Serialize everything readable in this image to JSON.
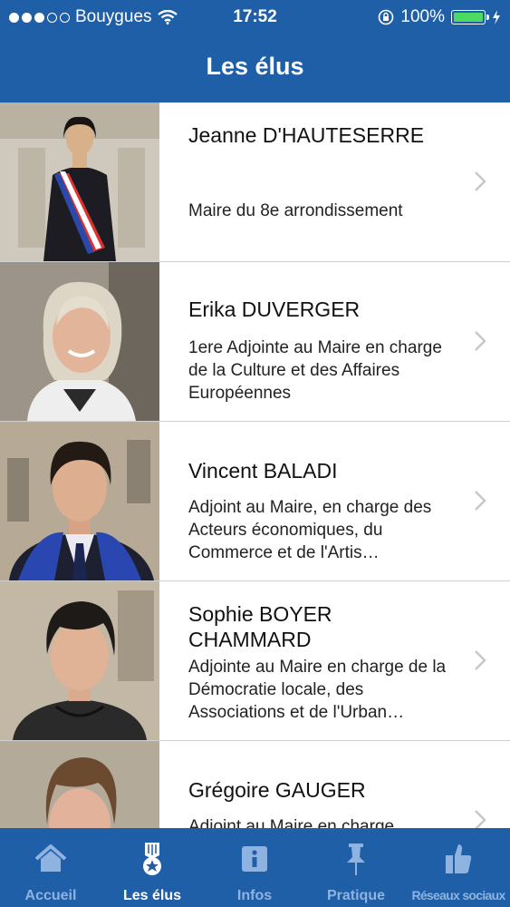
{
  "status_bar": {
    "carrier": "Bouygues",
    "time": "17:52",
    "battery": "100%",
    "signal_dots_filled": 3,
    "signal_dots_total": 5
  },
  "header": {
    "title": "Les élus"
  },
  "elus": [
    {
      "name": "Jeanne D'HAUTESERRE",
      "role": "Maire du 8e arrondissement"
    },
    {
      "name": "Erika DUVERGER",
      "role": "1ere Adjointe au Maire en charge de la Culture et des Affaires Européennes"
    },
    {
      "name": "Vincent BALADI",
      "role": "Adjoint au Maire, en charge des Acteurs économiques, du Commerce et de l'Artis…"
    },
    {
      "name": "Sophie BOYER CHAMMARD",
      "role": "Adjointe au Maire en charge de la Démocratie locale, des Associations et de l'Urban…"
    },
    {
      "name": "Grégoire GAUGER",
      "role": "Adjoint au Maire en charge"
    }
  ],
  "tabbar": {
    "tabs": [
      {
        "label": "Accueil",
        "icon": "home-icon"
      },
      {
        "label": "Les élus",
        "icon": "medal-icon"
      },
      {
        "label": "Infos",
        "icon": "info-icon"
      },
      {
        "label": "Pratique",
        "icon": "pin-icon"
      },
      {
        "label": "Réseaux sociaux",
        "icon": "thumbs-up-icon"
      }
    ],
    "active_index": 1
  },
  "colors": {
    "brand": "#1f5fa8",
    "tab_inactive": "#8fb3e0",
    "battery": "#4cd964"
  }
}
